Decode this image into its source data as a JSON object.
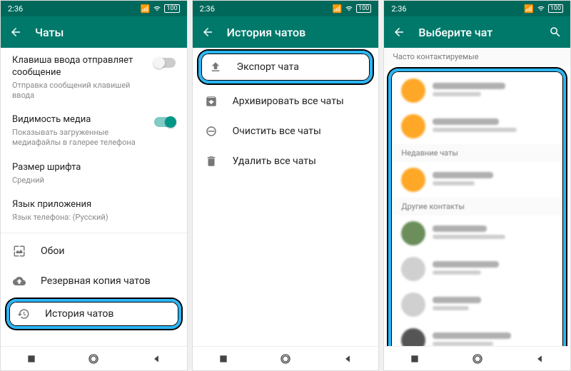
{
  "status": {
    "time": "2:36",
    "signal": "▮▮",
    "wifi": "wifi",
    "batt": "100"
  },
  "screen1": {
    "title": "Чаты",
    "settings": {
      "enterSend": {
        "title": "Клавиша ввода отправляет сообщение",
        "sub": "Отправка сообщений клавишей ввода",
        "on": false
      },
      "mediaVis": {
        "title": "Видимость медиа",
        "sub": "Показывать загруженные медиафайлы в галерее телефона",
        "on": true
      },
      "fontSize": {
        "title": "Размер шрифта",
        "sub": "Средний"
      },
      "appLang": {
        "title": "Язык приложения",
        "sub": "Язык телефона: (Русский)"
      }
    },
    "menu": {
      "wallpaper": "Обои",
      "backup": "Резервная копия чатов",
      "history": "История чатов"
    }
  },
  "screen2": {
    "title": "История чатов",
    "items": {
      "export": "Экспорт чата",
      "archive": "Архивировать все чаты",
      "clear": "Очистить все чаты",
      "delete": "Удалить все чаты"
    }
  },
  "screen3": {
    "title": "Выберите чат",
    "sections": {
      "frequent": "Часто контактируемые",
      "recent": "Недавние чаты",
      "other": "Другие контакты"
    }
  }
}
